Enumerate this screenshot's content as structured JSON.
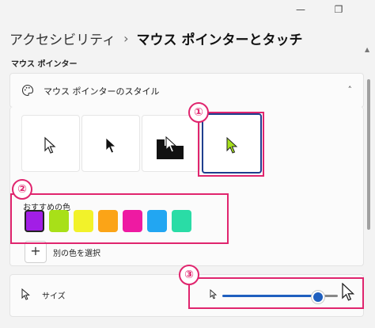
{
  "window": {
    "minimize_glyph": "—",
    "restore_glyph": "❐"
  },
  "breadcrumb": {
    "parent": "アクセシビリティ",
    "separator": "›",
    "current": "マウス ポインターとタッチ"
  },
  "section": {
    "label": "マウス ポインター"
  },
  "pointer_style": {
    "label": "マウス ポインターのスタイル",
    "icon": "palette-icon",
    "chevron": "˄",
    "options": [
      "white",
      "black",
      "inverted",
      "custom"
    ],
    "selected": "custom",
    "recommended_label": "おすすめの色",
    "recommended_colors": [
      "#a21ee6",
      "#a8e018",
      "#f2f22a",
      "#fba417",
      "#ee1aa2",
      "#22a6f2",
      "#2adca6"
    ],
    "selected_color": "#a21ee6",
    "custom_color_label": "別の色を選択",
    "add_glyph": "+",
    "custom_pointer_color": "#a6e01c"
  },
  "size": {
    "label": "サイズ",
    "icon": "pointer-icon",
    "slider_value_fraction": 0.9
  },
  "annotations": {
    "n1": "①",
    "n2": "②",
    "n3": "③",
    "color": "#e0256e"
  }
}
